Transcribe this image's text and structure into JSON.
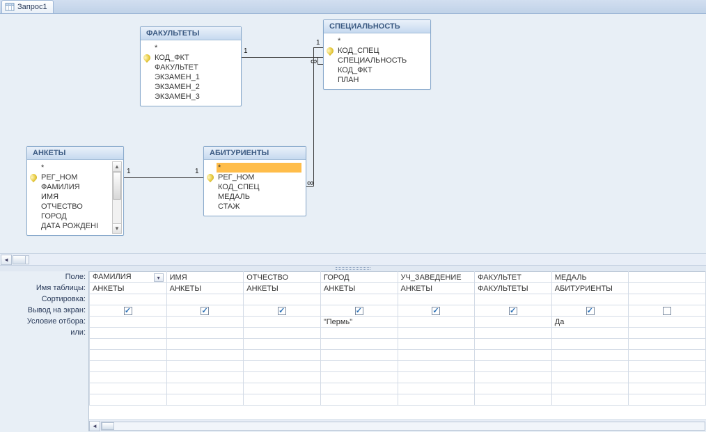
{
  "tab": {
    "title": "Запрос1"
  },
  "tables": {
    "fak": {
      "title": "ФАКУЛЬТЕТЫ",
      "star": "*",
      "fields": [
        "КОД_ФКТ",
        "ФАКУЛЬТЕТ",
        "ЭКЗАМЕН_1",
        "ЭКЗАМЕН_2",
        "ЭКЗАМЕН_3"
      ],
      "key_index": 0
    },
    "spec": {
      "title": "СПЕЦИАЛЬНОСТЬ",
      "star": "*",
      "fields": [
        "КОД_СПЕЦ",
        "СПЕЦИАЛЬНОСТЬ",
        "КОД_ФКТ",
        "ПЛАН"
      ],
      "key_index": 0
    },
    "ank": {
      "title": "АНКЕТЫ",
      "star": "*",
      "fields": [
        "РЕГ_НОМ",
        "ФАМИЛИЯ",
        "ИМЯ",
        "ОТЧЕСТВО",
        "ГОРОД",
        "ДАТА РОЖДЕНІ"
      ],
      "key_index": 0
    },
    "abit": {
      "title": "АБИТУРИЕНТЫ",
      "star": "*",
      "fields": [
        "РЕГ_НОМ",
        "КОД_СПЕЦ",
        "МЕДАЛЬ",
        "СТАЖ"
      ],
      "key_index": 0
    }
  },
  "relations": {
    "one": "1",
    "many": "∞"
  },
  "grid": {
    "labels": {
      "field": "Поле:",
      "table": "Имя таблицы:",
      "sort": "Сортировка:",
      "show": "Вывод на экран:",
      "criteria": "Условие отбора:",
      "or": "или:"
    },
    "columns": [
      {
        "field": "ФАМИЛИЯ",
        "table": "АНКЕТЫ",
        "show": true,
        "criteria": "",
        "active": true
      },
      {
        "field": "ИМЯ",
        "table": "АНКЕТЫ",
        "show": true,
        "criteria": ""
      },
      {
        "field": "ОТЧЕСТВО",
        "table": "АНКЕТЫ",
        "show": true,
        "criteria": ""
      },
      {
        "field": "ГОРОД",
        "table": "АНКЕТЫ",
        "show": true,
        "criteria": "\"Пермь\""
      },
      {
        "field": "УЧ_ЗАВЕДЕНИЕ",
        "table": "АНКЕТЫ",
        "show": true,
        "criteria": ""
      },
      {
        "field": "ФАКУЛЬТЕТ",
        "table": "ФАКУЛЬТЕТЫ",
        "show": true,
        "criteria": ""
      },
      {
        "field": "МЕДАЛЬ",
        "table": "АБИТУРИЕНТЫ",
        "show": true,
        "criteria": "Да"
      },
      {
        "field": "",
        "table": "",
        "show": false,
        "criteria": ""
      }
    ]
  }
}
